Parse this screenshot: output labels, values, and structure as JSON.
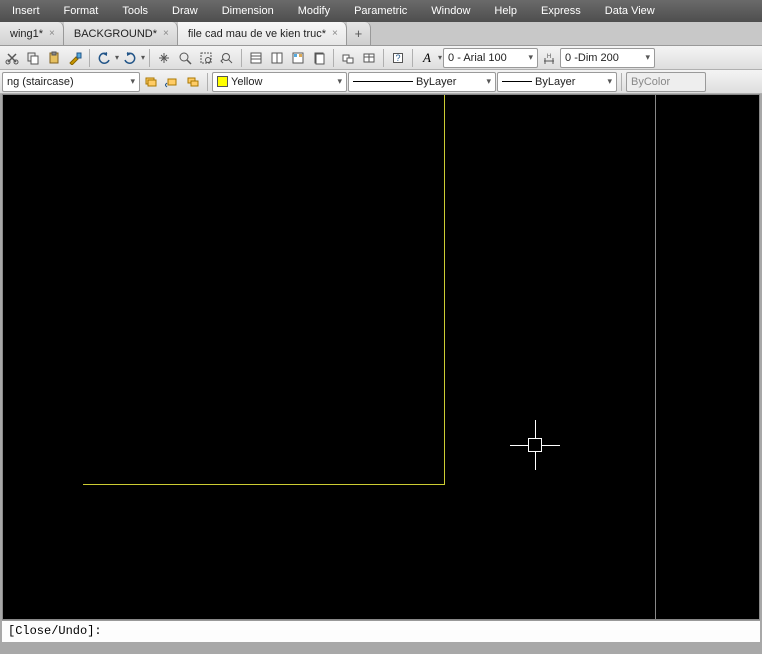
{
  "menu": {
    "items": [
      "Insert",
      "Format",
      "Tools",
      "Draw",
      "Dimension",
      "Modify",
      "Parametric",
      "Window",
      "Help",
      "Express",
      "Data View"
    ]
  },
  "tabs": {
    "items": [
      {
        "label": "wing1*"
      },
      {
        "label": "BACKGROUND*"
      },
      {
        "label": "file cad mau de ve kien truc*"
      }
    ],
    "activeIndex": 2
  },
  "toolbar1": {
    "textstyle": "0 - Arial 100",
    "dimstyle": "0 -Dim 200"
  },
  "toolbar2": {
    "layer": "ng (staircase)",
    "color": "Yellow",
    "linetype": "ByLayer",
    "lineweight": "ByLayer",
    "plotstyle": "ByColor"
  },
  "command": {
    "prompt": "[Close/Undo]:"
  },
  "icons": {
    "new": "new",
    "open": "open",
    "save": "save",
    "match": "match",
    "cut": "cut",
    "copy": "copy",
    "paste": "paste",
    "undo": "undo",
    "redo": "redo",
    "pan": "pan",
    "zoom": "zoom",
    "zoomwin": "zoomwin",
    "zoomext": "zoomext",
    "props": "props",
    "viewports": "viewports",
    "sheet": "sheet",
    "layout": "layout",
    "block": "block",
    "table": "table",
    "help": "help",
    "textA": "textA",
    "dim": "dim",
    "layerstate": "layerstate",
    "layeriso": "layeriso",
    "layermgr": "layermgr"
  }
}
